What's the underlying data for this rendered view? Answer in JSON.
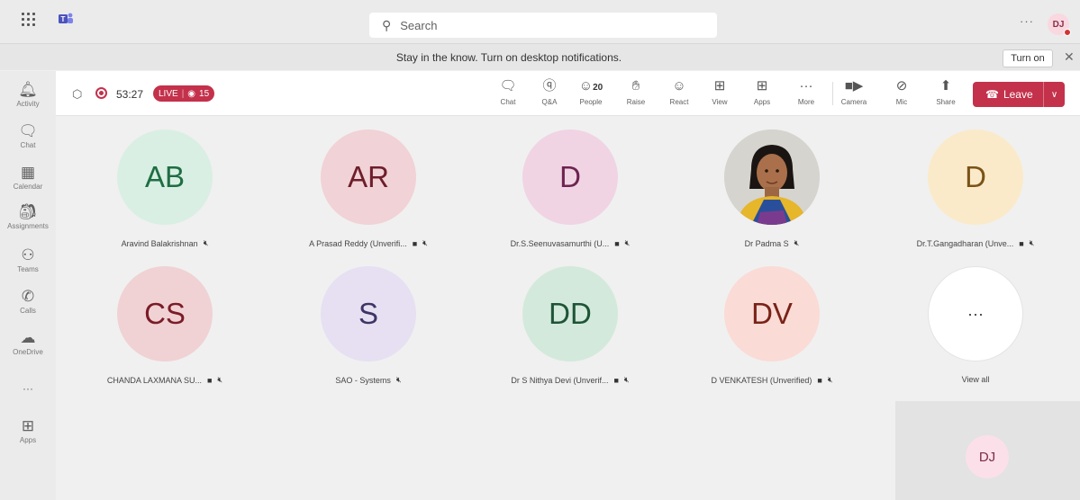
{
  "topbar": {
    "search_placeholder": "Search",
    "more_label": "···",
    "user_initials": "DJ"
  },
  "notification": {
    "text": "Stay in the know. Turn on desktop notifications.",
    "turn_on_label": "Turn on"
  },
  "rail": [
    {
      "label": "Activity",
      "icon": "bell-icon"
    },
    {
      "label": "Chat",
      "icon": "chat-icon"
    },
    {
      "label": "Calendar",
      "icon": "calendar-icon"
    },
    {
      "label": "Assignments",
      "icon": "assignments-icon"
    },
    {
      "label": "Teams",
      "icon": "teams-icon"
    },
    {
      "label": "Calls",
      "icon": "phone-icon"
    },
    {
      "label": "OneDrive",
      "icon": "cloud-icon"
    },
    {
      "label": "",
      "icon": "more-icon"
    },
    {
      "label": "Apps",
      "icon": "plus-icon"
    }
  ],
  "meeting": {
    "timer": "53:27",
    "live_label": "LIVE",
    "viewer_count": "15",
    "toolbar": {
      "chat": "Chat",
      "qa": "Q&A",
      "people": "People",
      "people_count": "20",
      "raise": "Raise",
      "react": "React",
      "view": "View",
      "apps": "Apps",
      "more": "More",
      "camera": "Camera",
      "mic": "Mic",
      "share": "Share",
      "leave": "Leave"
    }
  },
  "participants": [
    {
      "initials": "AB",
      "name": "Aravind Balakrishnan",
      "bg": "#d9efe3",
      "fg": "#1f6e43",
      "camera_off": false
    },
    {
      "initials": "AR",
      "name": "A Prasad Reddy (Unverifi...",
      "bg": "#f1d2d6",
      "fg": "#6e1e2b",
      "camera_off": true
    },
    {
      "initials": "D",
      "name": "Dr.S.Seenuvasamurthi (U...",
      "bg": "#f0d4e4",
      "fg": "#6e2350",
      "camera_off": true
    },
    {
      "initials": "",
      "name": "Dr Padma S",
      "photo": true,
      "camera_off": false
    },
    {
      "initials": "D",
      "name": "Dr.T.Gangadharan (Unve...",
      "bg": "#fbeac9",
      "fg": "#7a5318",
      "camera_off": true
    },
    {
      "initials": "CS",
      "name": "CHANDA LAXMANA SU...",
      "bg": "#f0d2d4",
      "fg": "#7a1c26",
      "camera_off": true
    },
    {
      "initials": "S",
      "name": "SAO - Systems",
      "bg": "#e6e0f2",
      "fg": "#3e3566",
      "camera_off": false
    },
    {
      "initials": "DD",
      "name": "Dr S Nithya Devi (Unverif...",
      "bg": "#d3e9dc",
      "fg": "#1e5436",
      "camera_off": true
    },
    {
      "initials": "DV",
      "name": "D VENKATESH (Unverified)",
      "bg": "#fadbd6",
      "fg": "#7a2217",
      "camera_off": true
    },
    {
      "initials": "···",
      "name": "View all",
      "bg": "#ffffff",
      "fg": "#333333",
      "camera_off": false,
      "view_all": true
    }
  ],
  "self_view": {
    "initials": "DJ"
  }
}
